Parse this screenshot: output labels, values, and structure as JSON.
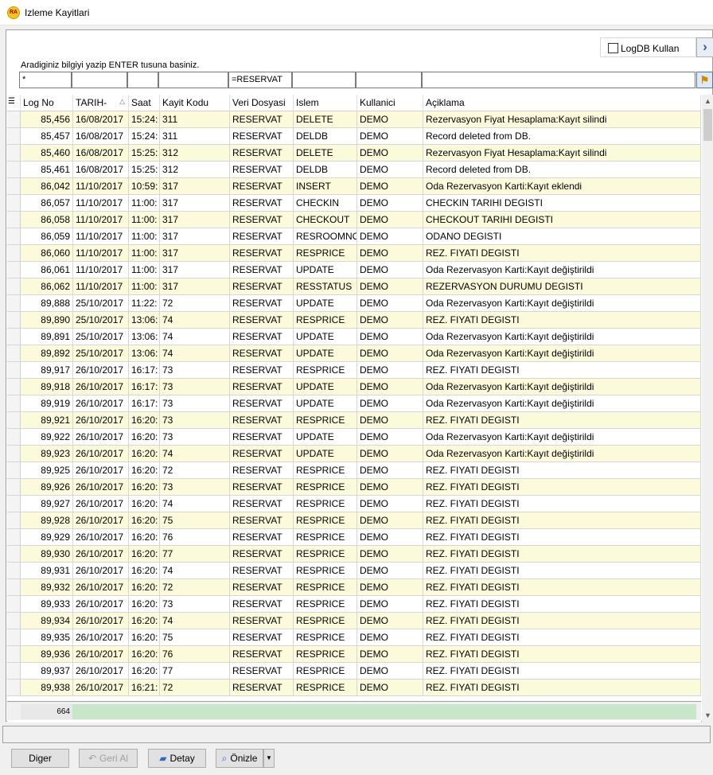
{
  "window": {
    "title": "Izleme Kayitlari"
  },
  "toolbar": {
    "logdb_label": "LogDB Kullan",
    "hint": "Aradiginiz bilgiyi yazip ENTER tusuna basiniz."
  },
  "filters": [
    "*",
    "",
    "",
    "",
    "=RESERVAT",
    "",
    "",
    ""
  ],
  "columns": [
    "Log No",
    "TARIH-",
    "Saat",
    "Kayit Kodu",
    "Veri Dosyasi",
    "Islem",
    "Kullanici",
    "Açiklama"
  ],
  "rows": [
    [
      "85,456",
      "16/08/2017",
      "15:24:",
      "311",
      "RESERVAT",
      "DELETE",
      "DEMO",
      "Rezervasyon Fiyat Hesaplama:Kayıt silindi"
    ],
    [
      "85,457",
      "16/08/2017",
      "15:24:",
      "311",
      "RESERVAT",
      "DELDB",
      "DEMO",
      "Record deleted from DB."
    ],
    [
      "85,460",
      "16/08/2017",
      "15:25:",
      "312",
      "RESERVAT",
      "DELETE",
      "DEMO",
      "Rezervasyon Fiyat Hesaplama:Kayıt silindi"
    ],
    [
      "85,461",
      "16/08/2017",
      "15:25:",
      "312",
      "RESERVAT",
      "DELDB",
      "DEMO",
      "Record deleted from DB."
    ],
    [
      "86,042",
      "11/10/2017",
      "10:59:",
      "317",
      "RESERVAT",
      "INSERT",
      "DEMO",
      "Oda Rezervasyon Karti:Kayıt eklendi"
    ],
    [
      "86,057",
      "11/10/2017",
      "11:00:",
      "317",
      "RESERVAT",
      "CHECKIN",
      "DEMO",
      "CHECKIN TARIHI DEGISTI"
    ],
    [
      "86,058",
      "11/10/2017",
      "11:00:",
      "317",
      "RESERVAT",
      "CHECKOUT",
      "DEMO",
      "CHECKOUT TARIHI DEGISTI"
    ],
    [
      "86,059",
      "11/10/2017",
      "11:00:",
      "317",
      "RESERVAT",
      "RESROOMNO",
      "DEMO",
      "ODANO DEGISTI"
    ],
    [
      "86,060",
      "11/10/2017",
      "11:00:",
      "317",
      "RESERVAT",
      "RESPRICE",
      "DEMO",
      "REZ. FIYATI DEGISTI"
    ],
    [
      "86,061",
      "11/10/2017",
      "11:00:",
      "317",
      "RESERVAT",
      "UPDATE",
      "DEMO",
      "Oda Rezervasyon Karti:Kayıt değiştirildi"
    ],
    [
      "86,062",
      "11/10/2017",
      "11:00:",
      "317",
      "RESERVAT",
      "RESSTATUS",
      "DEMO",
      "REZERVASYON DURUMU DEGISTI"
    ],
    [
      "89,888",
      "25/10/2017",
      "11:22:",
      "72",
      "RESERVAT",
      "UPDATE",
      "DEMO",
      "Oda Rezervasyon Karti:Kayıt değiştirildi"
    ],
    [
      "89,890",
      "25/10/2017",
      "13:06:",
      "74",
      "RESERVAT",
      "RESPRICE",
      "DEMO",
      "REZ. FIYATI DEGISTI"
    ],
    [
      "89,891",
      "25/10/2017",
      "13:06:",
      "74",
      "RESERVAT",
      "UPDATE",
      "DEMO",
      "Oda Rezervasyon Karti:Kayıt değiştirildi"
    ],
    [
      "89,892",
      "25/10/2017",
      "13:06:",
      "74",
      "RESERVAT",
      "UPDATE",
      "DEMO",
      "Oda Rezervasyon Karti:Kayıt değiştirildi"
    ],
    [
      "89,917",
      "26/10/2017",
      "16:17:",
      "73",
      "RESERVAT",
      "RESPRICE",
      "DEMO",
      "REZ. FIYATI DEGISTI"
    ],
    [
      "89,918",
      "26/10/2017",
      "16:17:",
      "73",
      "RESERVAT",
      "UPDATE",
      "DEMO",
      "Oda Rezervasyon Karti:Kayıt değiştirildi"
    ],
    [
      "89,919",
      "26/10/2017",
      "16:17:",
      "73",
      "RESERVAT",
      "UPDATE",
      "DEMO",
      "Oda Rezervasyon Karti:Kayıt değiştirildi"
    ],
    [
      "89,921",
      "26/10/2017",
      "16:20:",
      "73",
      "RESERVAT",
      "RESPRICE",
      "DEMO",
      "REZ. FIYATI DEGISTI"
    ],
    [
      "89,922",
      "26/10/2017",
      "16:20:",
      "73",
      "RESERVAT",
      "UPDATE",
      "DEMO",
      "Oda Rezervasyon Karti:Kayıt değiştirildi"
    ],
    [
      "89,923",
      "26/10/2017",
      "16:20:",
      "74",
      "RESERVAT",
      "UPDATE",
      "DEMO",
      "Oda Rezervasyon Karti:Kayıt değiştirildi"
    ],
    [
      "89,925",
      "26/10/2017",
      "16:20:",
      "72",
      "RESERVAT",
      "RESPRICE",
      "DEMO",
      "REZ. FIYATI DEGISTI"
    ],
    [
      "89,926",
      "26/10/2017",
      "16:20:",
      "73",
      "RESERVAT",
      "RESPRICE",
      "DEMO",
      "REZ. FIYATI DEGISTI"
    ],
    [
      "89,927",
      "26/10/2017",
      "16:20:",
      "74",
      "RESERVAT",
      "RESPRICE",
      "DEMO",
      "REZ. FIYATI DEGISTI"
    ],
    [
      "89,928",
      "26/10/2017",
      "16:20:",
      "75",
      "RESERVAT",
      "RESPRICE",
      "DEMO",
      "REZ. FIYATI DEGISTI"
    ],
    [
      "89,929",
      "26/10/2017",
      "16:20:",
      "76",
      "RESERVAT",
      "RESPRICE",
      "DEMO",
      "REZ. FIYATI DEGISTI"
    ],
    [
      "89,930",
      "26/10/2017",
      "16:20:",
      "77",
      "RESERVAT",
      "RESPRICE",
      "DEMO",
      "REZ. FIYATI DEGISTI"
    ],
    [
      "89,931",
      "26/10/2017",
      "16:20:",
      "74",
      "RESERVAT",
      "RESPRICE",
      "DEMO",
      "REZ. FIYATI DEGISTI"
    ],
    [
      "89,932",
      "26/10/2017",
      "16:20:",
      "72",
      "RESERVAT",
      "RESPRICE",
      "DEMO",
      "REZ. FIYATI DEGISTI"
    ],
    [
      "89,933",
      "26/10/2017",
      "16:20:",
      "73",
      "RESERVAT",
      "RESPRICE",
      "DEMO",
      "REZ. FIYATI DEGISTI"
    ],
    [
      "89,934",
      "26/10/2017",
      "16:20:",
      "74",
      "RESERVAT",
      "RESPRICE",
      "DEMO",
      "REZ. FIYATI DEGISTI"
    ],
    [
      "89,935",
      "26/10/2017",
      "16:20:",
      "75",
      "RESERVAT",
      "RESPRICE",
      "DEMO",
      "REZ. FIYATI DEGISTI"
    ],
    [
      "89,936",
      "26/10/2017",
      "16:20:",
      "76",
      "RESERVAT",
      "RESPRICE",
      "DEMO",
      "REZ. FIYATI DEGISTI"
    ],
    [
      "89,937",
      "26/10/2017",
      "16:20:",
      "77",
      "RESERVAT",
      "RESPRICE",
      "DEMO",
      "REZ. FIYATI DEGISTI"
    ],
    [
      "89,938",
      "26/10/2017",
      "16:21:",
      "72",
      "RESERVAT",
      "RESPRICE",
      "DEMO",
      "REZ. FIYATI DEGISTI"
    ]
  ],
  "footer": {
    "count": "664"
  },
  "buttons": {
    "diger": "Diger",
    "geri_al": "Geri Al",
    "detay": "Detay",
    "onizle": "Önizle"
  },
  "colors": {
    "row_odd": "#fbfbdc",
    "row_even": "#ffffff",
    "footer_bar": "#c8e6c9"
  }
}
